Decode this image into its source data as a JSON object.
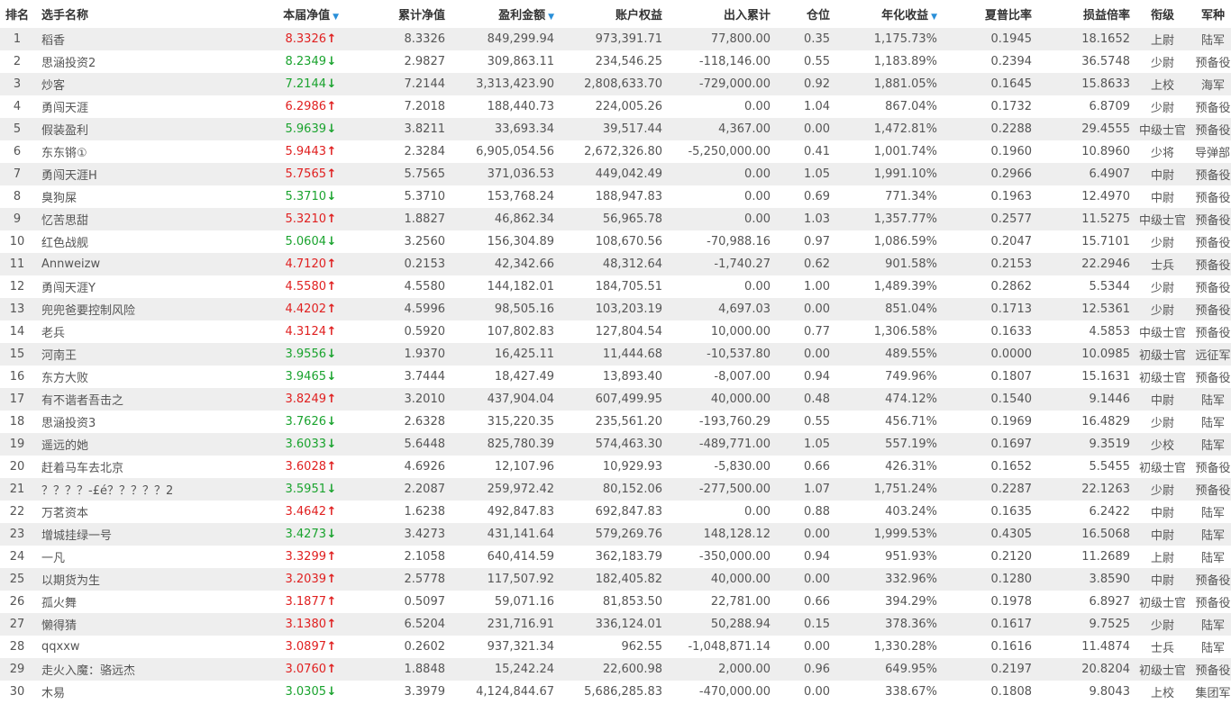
{
  "headers": {
    "rank": "排名",
    "name": "选手名称",
    "nav": "本届净值",
    "cum_nav": "累计净值",
    "profit": "盈利金额",
    "equity": "账户权益",
    "flow": "出入累计",
    "position": "仓位",
    "annual": "年化收益",
    "sharpe": "夏普比率",
    "pl_ratio": "损益倍率",
    "rank_title": "衔级",
    "branch": "军种"
  },
  "sort_icon": "caret-down-icon",
  "colors": {
    "up": "#e02020",
    "down": "#1aa32e",
    "sort": "#2a8fd8",
    "row_alt": "#eeeeee"
  },
  "rows": [
    {
      "rank": "1",
      "name": "稻香",
      "nav": "8.3326",
      "dir": "up",
      "cum": "8.3326",
      "profit": "849,299.94",
      "equity": "973,391.71",
      "flow": "77,800.00",
      "pos": "0.35",
      "annual": "1,175.73%",
      "sharpe": "0.1945",
      "pl": "18.1652",
      "title": "上尉",
      "branch": "陆军"
    },
    {
      "rank": "2",
      "name": "思涵投资2",
      "nav": "8.2349",
      "dir": "down",
      "cum": "2.9827",
      "profit": "309,863.11",
      "equity": "234,546.25",
      "flow": "-118,146.00",
      "pos": "0.55",
      "annual": "1,183.89%",
      "sharpe": "0.2394",
      "pl": "36.5748",
      "title": "少尉",
      "branch": "预备役"
    },
    {
      "rank": "3",
      "name": "炒客",
      "nav": "7.2144",
      "dir": "down",
      "cum": "7.2144",
      "profit": "3,313,423.90",
      "equity": "2,808,633.70",
      "flow": "-729,000.00",
      "pos": "0.92",
      "annual": "1,881.05%",
      "sharpe": "0.1645",
      "pl": "15.8633",
      "title": "上校",
      "branch": "海军"
    },
    {
      "rank": "4",
      "name": "勇闯天涯",
      "nav": "6.2986",
      "dir": "up",
      "cum": "7.2018",
      "profit": "188,440.73",
      "equity": "224,005.26",
      "flow": "0.00",
      "pos": "1.04",
      "annual": "867.04%",
      "sharpe": "0.1732",
      "pl": "6.8709",
      "title": "少尉",
      "branch": "预备役"
    },
    {
      "rank": "5",
      "name": "假装盈利",
      "nav": "5.9639",
      "dir": "down",
      "cum": "3.8211",
      "profit": "33,693.34",
      "equity": "39,517.44",
      "flow": "4,367.00",
      "pos": "0.00",
      "annual": "1,472.81%",
      "sharpe": "0.2288",
      "pl": "29.4555",
      "title": "中级士官",
      "branch": "预备役"
    },
    {
      "rank": "6",
      "name": "东东锵①",
      "nav": "5.9443",
      "dir": "up",
      "cum": "2.3284",
      "profit": "6,905,054.56",
      "equity": "2,672,326.80",
      "flow": "-5,250,000.00",
      "pos": "0.41",
      "annual": "1,001.74%",
      "sharpe": "0.1960",
      "pl": "10.8960",
      "title": "少将",
      "branch": "导弹部队"
    },
    {
      "rank": "7",
      "name": "勇闯天涯H",
      "nav": "5.7565",
      "dir": "up",
      "cum": "5.7565",
      "profit": "371,036.53",
      "equity": "449,042.49",
      "flow": "0.00",
      "pos": "1.05",
      "annual": "1,991.10%",
      "sharpe": "0.2966",
      "pl": "6.4907",
      "title": "中尉",
      "branch": "预备役"
    },
    {
      "rank": "8",
      "name": "臭狗屎",
      "nav": "5.3710",
      "dir": "down",
      "cum": "5.3710",
      "profit": "153,768.24",
      "equity": "188,947.83",
      "flow": "0.00",
      "pos": "0.69",
      "annual": "771.34%",
      "sharpe": "0.1963",
      "pl": "12.4970",
      "title": "中尉",
      "branch": "预备役"
    },
    {
      "rank": "9",
      "name": "忆苦思甜",
      "nav": "5.3210",
      "dir": "up",
      "cum": "1.8827",
      "profit": "46,862.34",
      "equity": "56,965.78",
      "flow": "0.00",
      "pos": "1.03",
      "annual": "1,357.77%",
      "sharpe": "0.2577",
      "pl": "11.5275",
      "title": "中级士官",
      "branch": "预备役"
    },
    {
      "rank": "10",
      "name": "红色战舰",
      "nav": "5.0604",
      "dir": "down",
      "cum": "3.2560",
      "profit": "156,304.89",
      "equity": "108,670.56",
      "flow": "-70,988.16",
      "pos": "0.97",
      "annual": "1,086.59%",
      "sharpe": "0.2047",
      "pl": "15.7101",
      "title": "少尉",
      "branch": "预备役"
    },
    {
      "rank": "11",
      "name": "Annweizw",
      "nav": "4.7120",
      "dir": "up",
      "cum": "0.2153",
      "profit": "42,342.66",
      "equity": "48,312.64",
      "flow": "-1,740.27",
      "pos": "0.62",
      "annual": "901.58%",
      "sharpe": "0.2153",
      "pl": "22.2946",
      "title": "士兵",
      "branch": "预备役"
    },
    {
      "rank": "12",
      "name": "勇闯天涯Y",
      "nav": "4.5580",
      "dir": "up",
      "cum": "4.5580",
      "profit": "144,182.01",
      "equity": "184,705.51",
      "flow": "0.00",
      "pos": "1.00",
      "annual": "1,489.39%",
      "sharpe": "0.2862",
      "pl": "5.5344",
      "title": "少尉",
      "branch": "预备役"
    },
    {
      "rank": "13",
      "name": "兜兜爸要控制风险",
      "nav": "4.4202",
      "dir": "up",
      "cum": "4.5996",
      "profit": "98,505.16",
      "equity": "103,203.19",
      "flow": "4,697.03",
      "pos": "0.00",
      "annual": "851.04%",
      "sharpe": "0.1713",
      "pl": "12.5361",
      "title": "少尉",
      "branch": "预备役"
    },
    {
      "rank": "14",
      "name": "老兵",
      "nav": "4.3124",
      "dir": "up",
      "cum": "0.5920",
      "profit": "107,802.83",
      "equity": "127,804.54",
      "flow": "10,000.00",
      "pos": "0.77",
      "annual": "1,306.58%",
      "sharpe": "0.1633",
      "pl": "4.5853",
      "title": "中级士官",
      "branch": "预备役"
    },
    {
      "rank": "15",
      "name": "河南王",
      "nav": "3.9556",
      "dir": "down",
      "cum": "1.9370",
      "profit": "16,425.11",
      "equity": "11,444.68",
      "flow": "-10,537.80",
      "pos": "0.00",
      "annual": "489.55%",
      "sharpe": "0.0000",
      "pl": "10.0985",
      "title": "初级士官",
      "branch": "远征军"
    },
    {
      "rank": "16",
      "name": "东方大败",
      "nav": "3.9465",
      "dir": "down",
      "cum": "3.7444",
      "profit": "18,427.49",
      "equity": "13,893.40",
      "flow": "-8,007.00",
      "pos": "0.94",
      "annual": "749.96%",
      "sharpe": "0.1807",
      "pl": "15.1631",
      "title": "初级士官",
      "branch": "预备役"
    },
    {
      "rank": "17",
      "name": "有不谐者吾击之",
      "nav": "3.8249",
      "dir": "up",
      "cum": "3.2010",
      "profit": "437,904.04",
      "equity": "607,499.95",
      "flow": "40,000.00",
      "pos": "0.48",
      "annual": "474.12%",
      "sharpe": "0.1540",
      "pl": "9.1446",
      "title": "中尉",
      "branch": "陆军"
    },
    {
      "rank": "18",
      "name": "思涵投资3",
      "nav": "3.7626",
      "dir": "down",
      "cum": "2.6328",
      "profit": "315,220.35",
      "equity": "235,561.20",
      "flow": "-193,760.29",
      "pos": "0.55",
      "annual": "456.71%",
      "sharpe": "0.1969",
      "pl": "16.4829",
      "title": "少尉",
      "branch": "陆军"
    },
    {
      "rank": "19",
      "name": "遥远的她",
      "nav": "3.6033",
      "dir": "down",
      "cum": "5.6448",
      "profit": "825,780.39",
      "equity": "574,463.30",
      "flow": "-489,771.00",
      "pos": "1.05",
      "annual": "557.19%",
      "sharpe": "0.1697",
      "pl": "9.3519",
      "title": "少校",
      "branch": "陆军"
    },
    {
      "rank": "20",
      "name": "赶着马车去北京",
      "nav": "3.6028",
      "dir": "up",
      "cum": "4.6926",
      "profit": "12,107.96",
      "equity": "10,929.93",
      "flow": "-5,830.00",
      "pos": "0.66",
      "annual": "426.31%",
      "sharpe": "0.1652",
      "pl": "5.5455",
      "title": "初级士官",
      "branch": "预备役"
    },
    {
      "rank": "21",
      "name": "？？？？-£é？？？？？2",
      "nav": "3.5951",
      "dir": "down",
      "cum": "2.2087",
      "profit": "259,972.42",
      "equity": "80,152.06",
      "flow": "-277,500.00",
      "pos": "1.07",
      "annual": "1,751.24%",
      "sharpe": "0.2287",
      "pl": "22.1263",
      "title": "少尉",
      "branch": "预备役"
    },
    {
      "rank": "22",
      "name": "万茗资本",
      "nav": "3.4642",
      "dir": "up",
      "cum": "1.6238",
      "profit": "492,847.83",
      "equity": "692,847.83",
      "flow": "0.00",
      "pos": "0.88",
      "annual": "403.24%",
      "sharpe": "0.1635",
      "pl": "6.2422",
      "title": "中尉",
      "branch": "陆军"
    },
    {
      "rank": "23",
      "name": "增城挂绿一号",
      "nav": "3.4273",
      "dir": "down",
      "cum": "3.4273",
      "profit": "431,141.64",
      "equity": "579,269.76",
      "flow": "148,128.12",
      "pos": "0.00",
      "annual": "1,999.53%",
      "sharpe": "0.4305",
      "pl": "16.5068",
      "title": "中尉",
      "branch": "陆军"
    },
    {
      "rank": "24",
      "name": "一凡",
      "nav": "3.3299",
      "dir": "up",
      "cum": "2.1058",
      "profit": "640,414.59",
      "equity": "362,183.79",
      "flow": "-350,000.00",
      "pos": "0.94",
      "annual": "951.93%",
      "sharpe": "0.2120",
      "pl": "11.2689",
      "title": "上尉",
      "branch": "陆军"
    },
    {
      "rank": "25",
      "name": "以期货为生",
      "nav": "3.2039",
      "dir": "up",
      "cum": "2.5778",
      "profit": "117,507.92",
      "equity": "182,405.82",
      "flow": "40,000.00",
      "pos": "0.00",
      "annual": "332.96%",
      "sharpe": "0.1280",
      "pl": "3.8590",
      "title": "中尉",
      "branch": "预备役"
    },
    {
      "rank": "26",
      "name": "孤火舞",
      "nav": "3.1877",
      "dir": "up",
      "cum": "0.5097",
      "profit": "59,071.16",
      "equity": "81,853.50",
      "flow": "22,781.00",
      "pos": "0.66",
      "annual": "394.29%",
      "sharpe": "0.1978",
      "pl": "6.8927",
      "title": "初级士官",
      "branch": "预备役"
    },
    {
      "rank": "27",
      "name": "懒得猜",
      "nav": "3.1380",
      "dir": "up",
      "cum": "6.5204",
      "profit": "231,716.91",
      "equity": "336,124.01",
      "flow": "50,288.94",
      "pos": "0.15",
      "annual": "378.36%",
      "sharpe": "0.1617",
      "pl": "9.7525",
      "title": "少尉",
      "branch": "陆军"
    },
    {
      "rank": "28",
      "name": "qqxxw",
      "nav": "3.0897",
      "dir": "up",
      "cum": "0.2602",
      "profit": "937,321.34",
      "equity": "962.55",
      "flow": "-1,048,871.14",
      "pos": "0.00",
      "annual": "1,330.28%",
      "sharpe": "0.1616",
      "pl": "11.4874",
      "title": "士兵",
      "branch": "陆军"
    },
    {
      "rank": "29",
      "name": "走火入魔：骆远杰",
      "nav": "3.0760",
      "dir": "up",
      "cum": "1.8848",
      "profit": "15,242.24",
      "equity": "22,600.98",
      "flow": "2,000.00",
      "pos": "0.96",
      "annual": "649.95%",
      "sharpe": "0.2197",
      "pl": "20.8204",
      "title": "初级士官",
      "branch": "预备役"
    },
    {
      "rank": "30",
      "name": "木易",
      "nav": "3.0305",
      "dir": "down",
      "cum": "3.3979",
      "profit": "4,124,844.67",
      "equity": "5,686,285.83",
      "flow": "-470,000.00",
      "pos": "0.00",
      "annual": "338.67%",
      "sharpe": "0.1808",
      "pl": "9.8043",
      "title": "上校",
      "branch": "集团军"
    }
  ]
}
